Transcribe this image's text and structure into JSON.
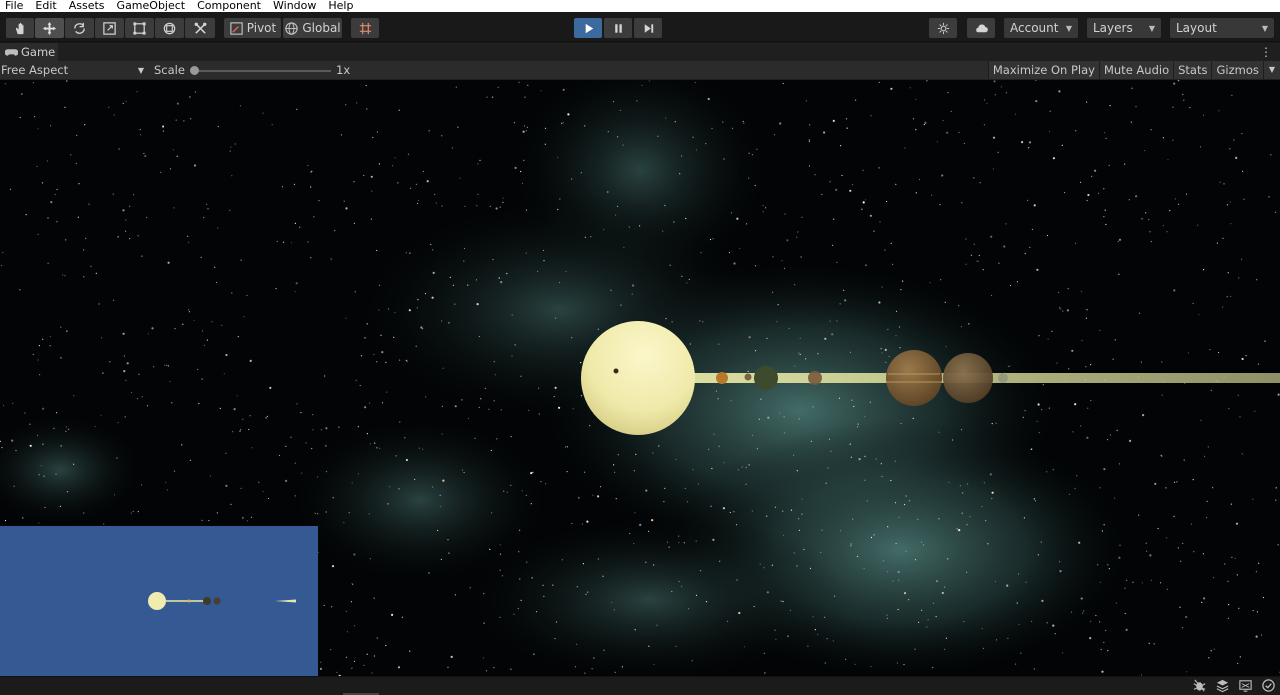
{
  "menu": [
    "File",
    "Edit",
    "Assets",
    "GameObject",
    "Component",
    "Window",
    "Help"
  ],
  "toolbar": {
    "pivot_label": "Pivot",
    "global_label": "Global",
    "account_label": "Account",
    "layers_label": "Layers",
    "layout_label": "Layout",
    "icons": [
      "hand-tool",
      "move-tool",
      "rotate-tool",
      "scale-tool",
      "rect-tool",
      "transform-tool",
      "custom-tool",
      "pivot-icon",
      "global-icon",
      "grid-snap-icon",
      "play-icon",
      "pause-icon",
      "step-icon",
      "services-icon",
      "cloud-icon"
    ]
  },
  "game_tab": {
    "label": "Game",
    "aspect_label": "Free Aspect",
    "scale_label": "Scale",
    "scale_value": "1x",
    "scale_level": 0.0,
    "right_buttons": [
      "Maximize On Play",
      "Mute Audio",
      "Stats",
      "Gizmos"
    ]
  },
  "colors": {
    "accent_play": "#3d6a9e",
    "minimap_bg": "#355a93",
    "sun": "#f3efb4",
    "orbit_beam": "#d8d89a"
  }
}
